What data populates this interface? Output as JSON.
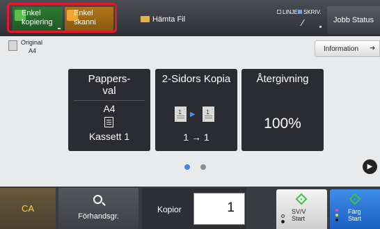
{
  "topbar": {
    "modes": [
      {
        "label": "Enkel\nkopiering"
      },
      {
        "label": "Enkel\nskanni"
      }
    ],
    "fetch_label": "Hämta Fil",
    "status_linje": "LINJE",
    "status_skriv": "SKRIV.",
    "jobb_status_label": "Jobb Status"
  },
  "main": {
    "original_label": "Original",
    "original_size": "A4",
    "information_label": "Information",
    "tiles": [
      {
        "title": "Pappers-\nval",
        "size": "A4",
        "tray": "Kassett 1"
      },
      {
        "title": "2-Sidors Kopia",
        "page1": "1",
        "page2": "1",
        "ratio": "1 → 1"
      },
      {
        "title": "Återgivning",
        "value": "100%"
      }
    ]
  },
  "bottom": {
    "ca_label": "CA",
    "preview_label": "Förhandsgr.",
    "kopior_label": "Kopior",
    "kopior_value": "1",
    "svv_start_label": "SV/V\nStart",
    "farg_start_label": "Färg\nStart"
  },
  "colors": {
    "highlight": "#e8182c",
    "accent_blue": "#3c87e8",
    "copy_green": "#5bbf4e",
    "scan_orange": "#f1a533"
  }
}
